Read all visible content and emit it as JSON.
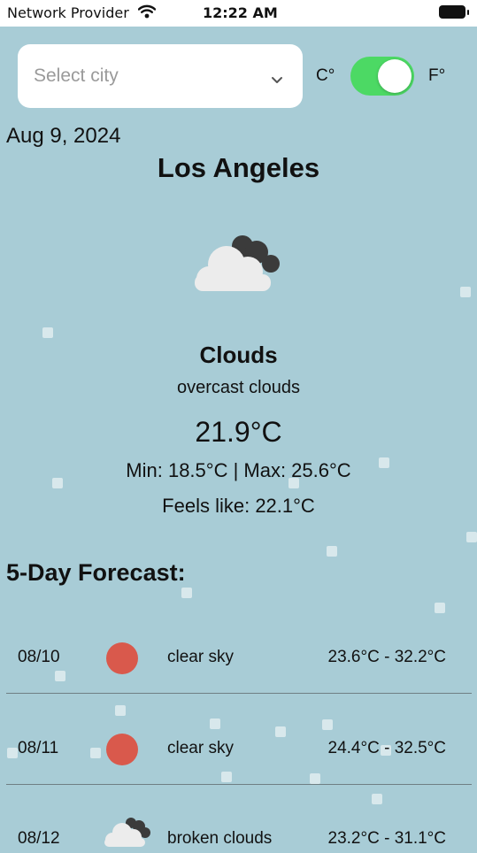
{
  "status_bar": {
    "carrier": "Network Provider",
    "time": "12:22 AM",
    "wifi_icon": "wifi-icon",
    "battery_icon": "battery-icon"
  },
  "city_select": {
    "placeholder": "Select city",
    "icon": "chevron-down-icon"
  },
  "units": {
    "celsius_label": "C°",
    "fahrenheit_label": "F°",
    "toggle_on": true,
    "toggle_color": "#4cd964"
  },
  "current": {
    "date": "Aug 9, 2024",
    "city": "Los Angeles",
    "icon": "clouds-icon",
    "condition": "Clouds",
    "description": "overcast clouds",
    "temperature": "21.9°C",
    "min_max": "Min: 18.5°C | Max: 25.6°C",
    "feels_like": "Feels like: 22.1°C"
  },
  "forecast": {
    "title": "5-Day Forecast:",
    "days": [
      {
        "date": "08/10",
        "icon": "clear-sky-icon",
        "description": "clear sky",
        "range": "23.6°C - 32.2°C"
      },
      {
        "date": "08/11",
        "icon": "clear-sky-icon",
        "description": "clear sky",
        "range": "24.4°C - 32.5°C"
      },
      {
        "date": "08/12",
        "icon": "broken-clouds-icon",
        "description": "broken clouds",
        "range": "23.2°C - 31.1°C"
      }
    ]
  },
  "colors": {
    "background": "#a8ccd6",
    "sun": "#d9594c",
    "toggle_on": "#4cd964"
  }
}
